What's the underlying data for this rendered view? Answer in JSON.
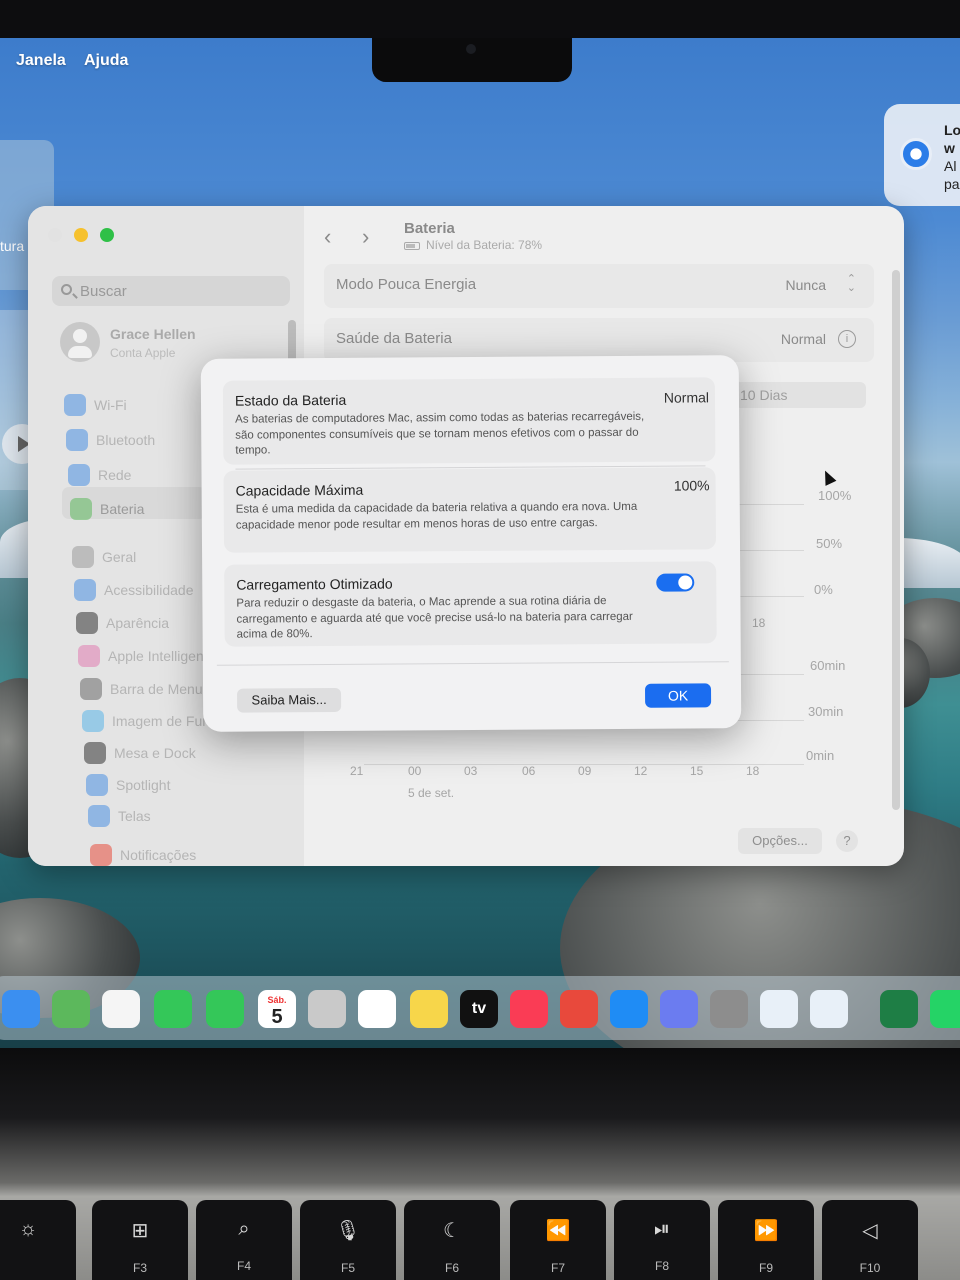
{
  "menubar": {
    "items": [
      "Janela",
      "Ajuda"
    ]
  },
  "notification": {
    "lines": [
      "Lo",
      "w",
      "Al",
      "pa"
    ]
  },
  "left_partial_label": "tura",
  "window": {
    "search_placeholder": "Buscar",
    "user": {
      "name": "Grace Hellen",
      "subtitle": "Conta Apple"
    },
    "sidebar": [
      {
        "label": "Wi-Fi",
        "icon": "wifi-icon",
        "color": "#4a90e2"
      },
      {
        "label": "Bluetooth",
        "icon": "bluetooth-icon",
        "color": "#4a90e2"
      },
      {
        "label": "Rede",
        "icon": "globe-icon",
        "color": "#4a90e2"
      },
      {
        "label": "Bateria",
        "icon": "battery-icon",
        "color": "#5cb85c"
      },
      {
        "label": "Geral",
        "icon": "gear-icon",
        "color": "#9a9a9a"
      },
      {
        "label": "Acessibilidade",
        "icon": "accessibility-icon",
        "color": "#4a90e2"
      },
      {
        "label": "Aparência",
        "icon": "appearance-icon",
        "color": "#333333"
      },
      {
        "label": "Apple Intelligenc",
        "icon": "apple-intelligence-icon",
        "color": "#e07bb0"
      },
      {
        "label": "Barra de Menus",
        "icon": "menubar-icon",
        "color": "#6a6a6a"
      },
      {
        "label": "Imagem de Fundo",
        "icon": "wallpaper-icon",
        "color": "#5ab4e8"
      },
      {
        "label": "Mesa e Dock",
        "icon": "dock-icon",
        "color": "#333333"
      },
      {
        "label": "Spotlight",
        "icon": "spotlight-icon",
        "color": "#4a90e2"
      },
      {
        "label": "Telas",
        "icon": "displays-icon",
        "color": "#4a90e2"
      },
      {
        "label": "Notificações",
        "icon": "notifications-icon",
        "color": "#e74c3c"
      }
    ],
    "page": {
      "title": "Bateria",
      "subtitle": "Nível da Bateria: 78%",
      "rows": [
        {
          "label": "Modo Pouca Energia",
          "value": "Nunca"
        },
        {
          "label": "Saúde da Bateria",
          "value": "Normal"
        }
      ],
      "range_tab": "10 Dias",
      "chart_levels": [
        "100%",
        "50%",
        "0%"
      ],
      "chart_usage": [
        "60min",
        "30min",
        "0min"
      ],
      "x_ticks": [
        "21",
        "00",
        "03",
        "06",
        "09",
        "12",
        "15",
        "18"
      ],
      "upper_tick": "18",
      "date_label": "5 de set.",
      "options_label": "Opções...",
      "help_label": "?"
    }
  },
  "modal": {
    "sections": [
      {
        "title": "Estado da Bateria",
        "value": "Normal",
        "desc": "As baterias de computadores Mac, assim como todas as baterias recarregáveis, são componentes consumíveis que se tornam menos efetivos com o passar do tempo."
      },
      {
        "title": "Capacidade Máxima",
        "value": "100%",
        "desc": "Esta é uma medida da capacidade da bateria relativa a quando era nova. Uma capacidade menor pode resultar em menos horas de uso entre cargas."
      },
      {
        "title": "Carregamento Otimizado",
        "value": "",
        "desc": "Para reduzir o desgaste da bateria, o Mac aprende a sua rotina diária de carregamento e aguarda até que você precise usá-lo na bateria para carregar acima de 80%."
      }
    ],
    "toggle_on": true,
    "more_label": "Saiba Mais...",
    "ok_label": "OK"
  },
  "dock": {
    "calendar_month": "Sáb.",
    "calendar_day": "5",
    "tv_label": "tv",
    "apps": [
      {
        "name": "mail-icon",
        "color": "#3b8ff0"
      },
      {
        "name": "maps-icon",
        "color": "#5cb85c"
      },
      {
        "name": "photos-icon",
        "color": "#f5f5f5"
      },
      {
        "name": "facetime-icon",
        "color": "#34c759"
      },
      {
        "name": "phone-icon",
        "color": "#34c759"
      },
      {
        "name": "calendar-icon",
        "color": "#ffffff"
      },
      {
        "name": "contacts-icon",
        "color": "#c9c9c9"
      },
      {
        "name": "reminders-icon",
        "color": "#ffffff"
      },
      {
        "name": "notes-icon",
        "color": "#f7d64a"
      },
      {
        "name": "appletv-icon",
        "color": "#111111"
      },
      {
        "name": "music-icon",
        "color": "#fa3c55"
      },
      {
        "name": "rocket-icon",
        "color": "#e8493c"
      },
      {
        "name": "appstore-icon",
        "color": "#1f8cf5"
      },
      {
        "name": "iphone-mirroring-icon",
        "color": "#6b7cf0"
      },
      {
        "name": "system-settings-icon",
        "color": "#8d8d8d"
      },
      {
        "name": "sketchup-icon",
        "color": "#e8f0f8"
      },
      {
        "name": "layers-icon",
        "color": "#e8f0f8"
      },
      {
        "name": "excel-icon",
        "color": "#1e7e45"
      },
      {
        "name": "whatsapp-icon",
        "color": "#25d366"
      }
    ]
  },
  "keyboard": {
    "keys": [
      {
        "glyph": "☼",
        "fn": "",
        "icon": "brightness-icon"
      },
      {
        "glyph": "⊞",
        "fn": "F3",
        "icon": "mission-control-icon"
      },
      {
        "glyph": "⌕",
        "fn": "F4",
        "icon": "search-icon"
      },
      {
        "glyph": "🎙",
        "fn": "F5",
        "icon": "microphone-icon"
      },
      {
        "glyph": "☾",
        "fn": "F6",
        "icon": "moon-icon"
      },
      {
        "glyph": "⏪",
        "fn": "F7",
        "icon": "rewind-icon"
      },
      {
        "glyph": "⏯",
        "fn": "F8",
        "icon": "play-pause-icon"
      },
      {
        "glyph": "⏩",
        "fn": "F9",
        "icon": "fast-forward-icon"
      },
      {
        "glyph": "◁",
        "fn": "F10",
        "icon": "mute-icon"
      }
    ]
  }
}
